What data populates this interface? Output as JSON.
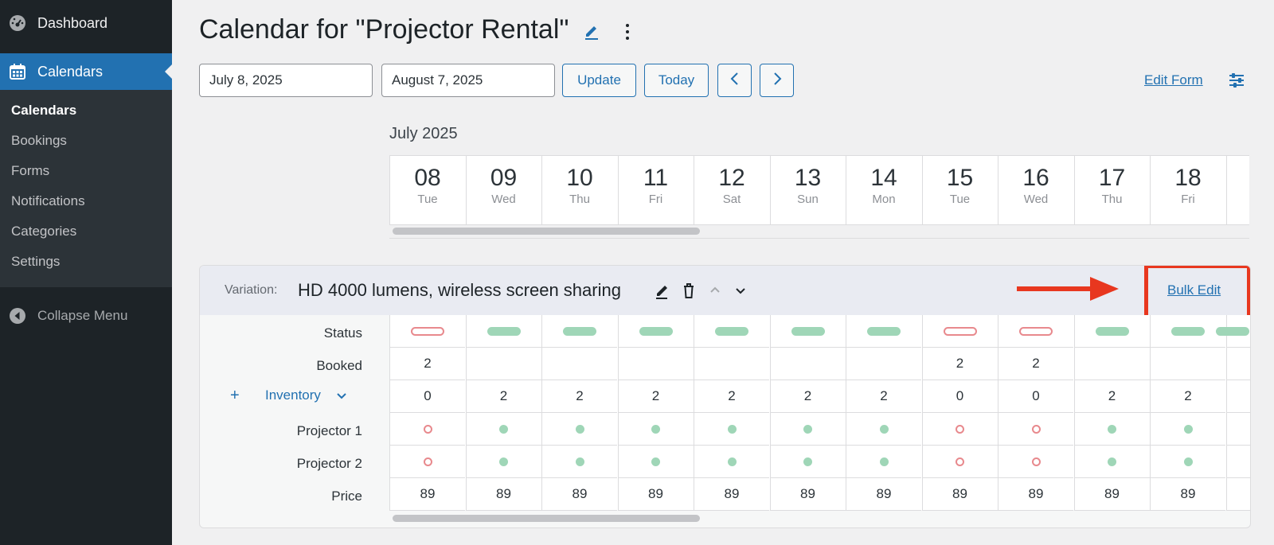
{
  "sidebar": {
    "dashboard": "Dashboard",
    "calendars": "Calendars",
    "submenu": [
      "Calendars",
      "Bookings",
      "Forms",
      "Notifications",
      "Categories",
      "Settings"
    ],
    "collapse": "Collapse Menu"
  },
  "header": {
    "title": "Calendar for \"Projector Rental\""
  },
  "toolbar": {
    "start_date": "July 8, 2025",
    "end_date": "August 7, 2025",
    "update": "Update",
    "today": "Today",
    "edit_form": "Edit Form"
  },
  "calendar": {
    "month": "July 2025",
    "days": [
      {
        "num": "08",
        "dow": "Tue"
      },
      {
        "num": "09",
        "dow": "Wed"
      },
      {
        "num": "10",
        "dow": "Thu"
      },
      {
        "num": "11",
        "dow": "Fri"
      },
      {
        "num": "12",
        "dow": "Sat"
      },
      {
        "num": "13",
        "dow": "Sun"
      },
      {
        "num": "14",
        "dow": "Mon"
      },
      {
        "num": "15",
        "dow": "Tue"
      },
      {
        "num": "16",
        "dow": "Wed"
      },
      {
        "num": "17",
        "dow": "Thu"
      },
      {
        "num": "18",
        "dow": "Fri"
      }
    ]
  },
  "variation": {
    "label": "Variation:",
    "name": "HD 4000 lumens, wireless screen sharing",
    "bulk_edit": "Bulk Edit",
    "rows": {
      "status": "Status",
      "booked": "Booked",
      "inventory": "Inventory",
      "projector1": "Projector 1",
      "projector2": "Projector 2",
      "price": "Price"
    },
    "inventory_add": "+",
    "status_values": [
      "unavailable",
      "available",
      "available",
      "available",
      "available",
      "available",
      "available",
      "unavailable",
      "unavailable",
      "available",
      "available"
    ],
    "booked_values": [
      "2",
      "",
      "",
      "",
      "",
      "",
      "",
      "2",
      "2",
      "",
      ""
    ],
    "inventory_values": [
      "0",
      "2",
      "2",
      "2",
      "2",
      "2",
      "2",
      "0",
      "0",
      "2",
      "2"
    ],
    "projector1_values": [
      "unavailable",
      "available",
      "available",
      "available",
      "available",
      "available",
      "available",
      "unavailable",
      "unavailable",
      "available",
      "available"
    ],
    "projector2_values": [
      "unavailable",
      "available",
      "available",
      "available",
      "available",
      "available",
      "available",
      "unavailable",
      "unavailable",
      "available",
      "available"
    ],
    "price_values": [
      "89",
      "89",
      "89",
      "89",
      "89",
      "89",
      "89",
      "89",
      "89",
      "89",
      "89"
    ]
  },
  "colors": {
    "accent": "#2271b1",
    "available": "#9fd6b7",
    "unavailable": "#e8898d",
    "highlight": "#e8371f"
  }
}
